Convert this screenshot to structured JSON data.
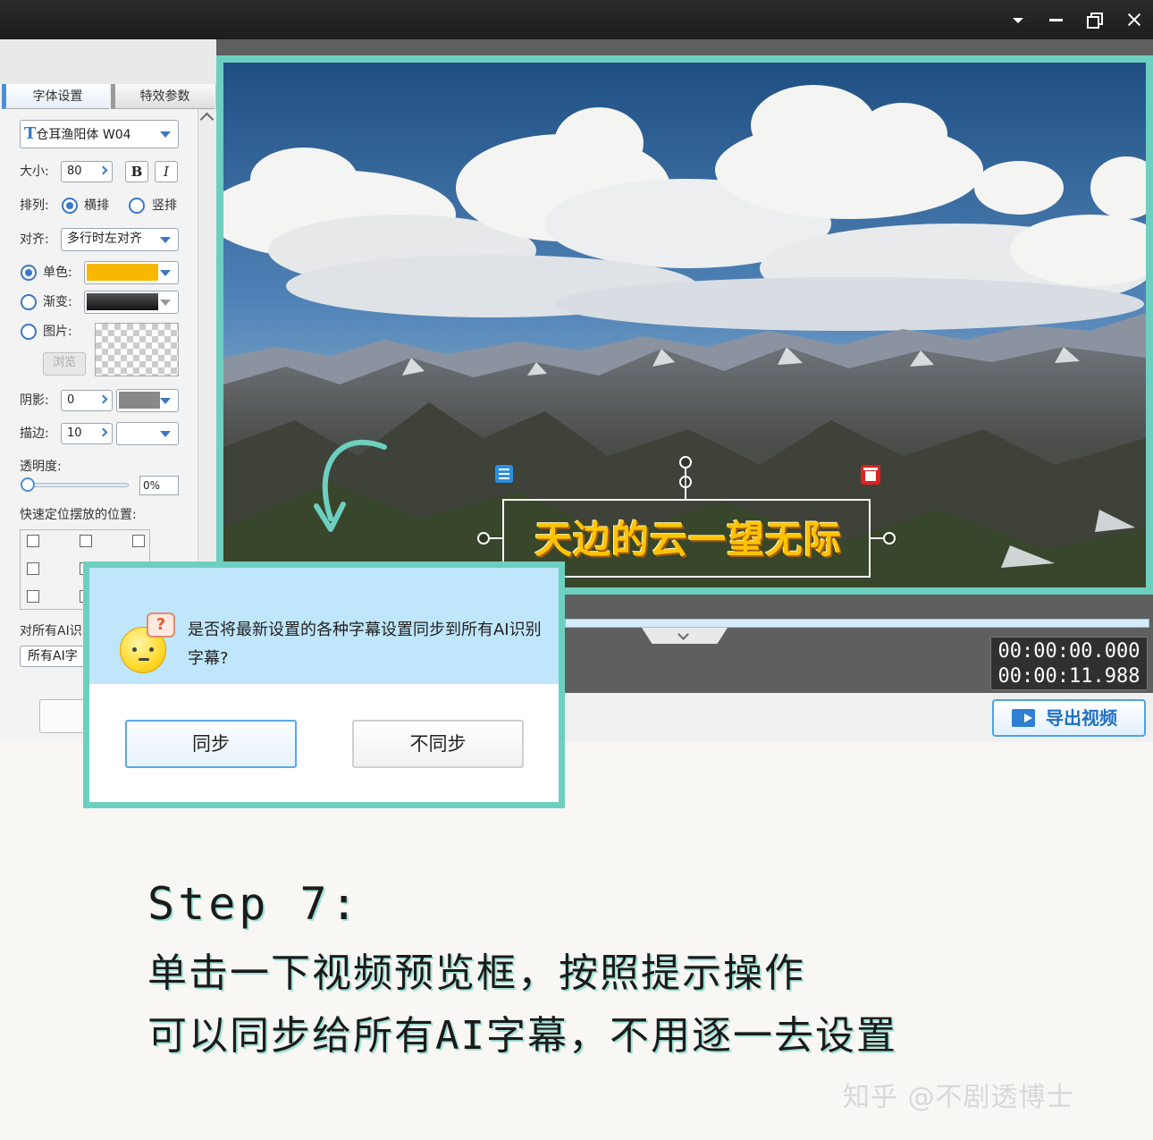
{
  "window": {
    "controls": [
      "chevron-down-icon",
      "minimize-icon",
      "restore-icon",
      "close-icon"
    ]
  },
  "left_panel": {
    "tabs": [
      {
        "label": "字体设置",
        "active": true
      },
      {
        "label": "特效参数",
        "active": false
      }
    ],
    "font": {
      "icon": "T",
      "value": "仓耳渔阳体 W04"
    },
    "size": {
      "label": "大小:",
      "value": "80",
      "bold": "B",
      "italic": "I"
    },
    "arrange": {
      "label": "排列:",
      "options": [
        "横排",
        "竖排"
      ],
      "selected": "横排"
    },
    "align": {
      "label": "对齐:",
      "value": "多行时左对齐"
    },
    "fill": {
      "solid_label": "单色:",
      "solid_color": "#f7b800",
      "gradient_label": "渐变:",
      "image_label": "图片:",
      "browse": "浏览",
      "selected": "单色"
    },
    "shadow": {
      "label": "阴影:",
      "value": "0",
      "color": "#888888"
    },
    "stroke": {
      "label": "描边:",
      "value": "10"
    },
    "opacity": {
      "label": "透明度:",
      "value": "0%",
      "slider_level": 0
    },
    "position": {
      "label": "快速定位摆放的位置:"
    },
    "apply_all": {
      "label": "对所有AI识",
      "value": "所有AI字"
    }
  },
  "preview": {
    "subtitle": "天边的云一望无际",
    "accent": "#6dcfbf",
    "subtitle_color": "#ffc400"
  },
  "timeline": {
    "current_time": "00:00:00.000",
    "total_time": "00:00:11.988"
  },
  "export": {
    "label": "导出视频"
  },
  "dialog": {
    "message": "是否将最新设置的各种字幕设置同步到所有AI识别字幕?",
    "bubble": "?",
    "sync": "同步",
    "no_sync": "不同步"
  },
  "caption": {
    "step": "Step 7:",
    "line1": "单击一下视频预览框，按照提示操作",
    "line2": "可以同步给所有AI字幕，不用逐一去设置"
  },
  "watermark": "知乎 @不剧透博士"
}
